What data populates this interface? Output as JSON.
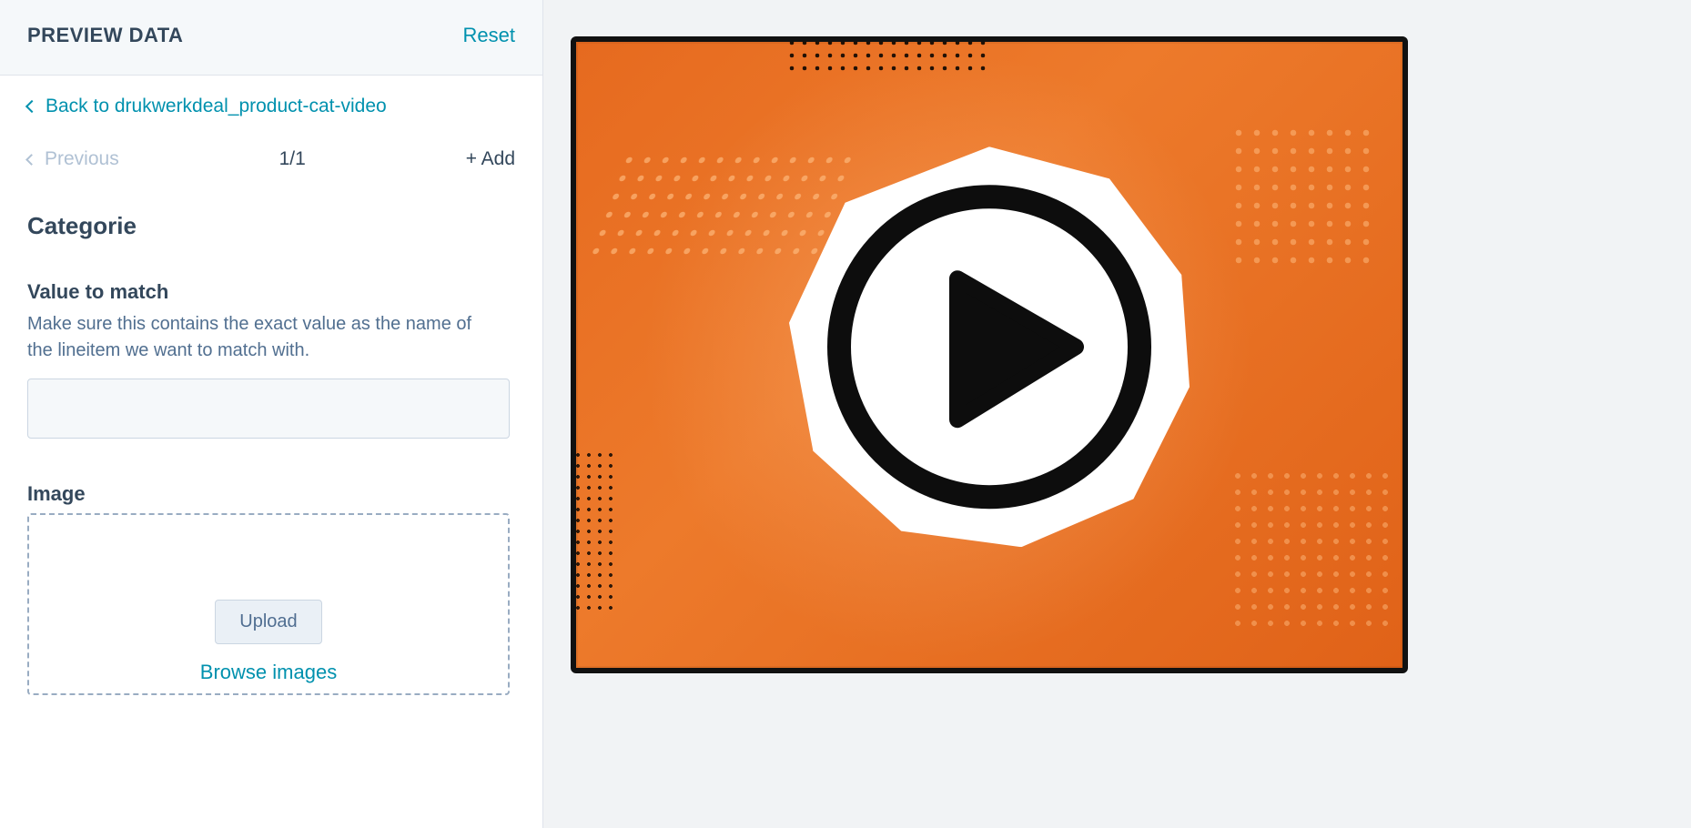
{
  "header": {
    "title": "PREVIEW DATA",
    "reset": "Reset"
  },
  "back_link": "Back to drukwerkdeal_product-cat-video",
  "nav": {
    "previous": "Previous",
    "page": "1/1",
    "add": "+ Add"
  },
  "section_title": "Categorie",
  "field_value": {
    "label": "Value to match",
    "help": "Make sure this contains the exact value as the name of the lineitem we want to match with.",
    "value": ""
  },
  "field_image": {
    "label": "Image",
    "upload": "Upload",
    "browse": "Browse images"
  },
  "preview": {
    "icon": "play-icon",
    "accent": "#e66a1f"
  }
}
